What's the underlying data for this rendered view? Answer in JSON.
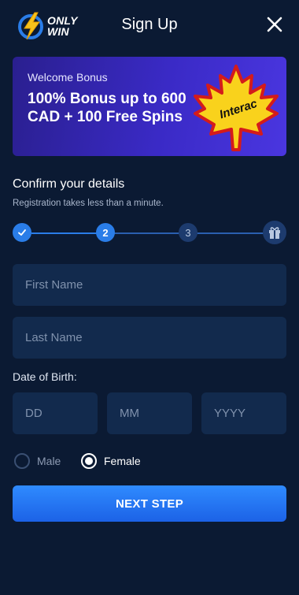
{
  "header": {
    "brand_line1": "ONLY",
    "brand_line2": "WIN",
    "title": "Sign Up",
    "close_icon": "close-icon"
  },
  "banner": {
    "subtitle": "Welcome Bonus",
    "headline": "100% Bonus up to 600 CAD + 100 Free Spins",
    "badge_text": "Interac",
    "art_icon": "maple-leaf-interac-icon"
  },
  "form": {
    "title": "Confirm your details",
    "subtitle": "Registration takes less than a minute.",
    "stepper": {
      "step1_icon": "check-icon",
      "step2": "2",
      "step3": "3",
      "step4_icon": "gift-icon",
      "current_step": 2
    },
    "first_name_placeholder": "First Name",
    "last_name_placeholder": "Last Name",
    "dob_label": "Date of Birth:",
    "day_placeholder": "DD",
    "month_placeholder": "MM",
    "year_placeholder": "YYYY",
    "gender_male": "Male",
    "gender_female": "Female",
    "gender_selected": "Female",
    "next_button": "NEXT STEP"
  },
  "colors": {
    "background": "#0b1a33",
    "field": "#122a4d",
    "accent": "#2a7de8",
    "banner": "#3a2ac6",
    "brand_yellow": "#f7c21b"
  }
}
